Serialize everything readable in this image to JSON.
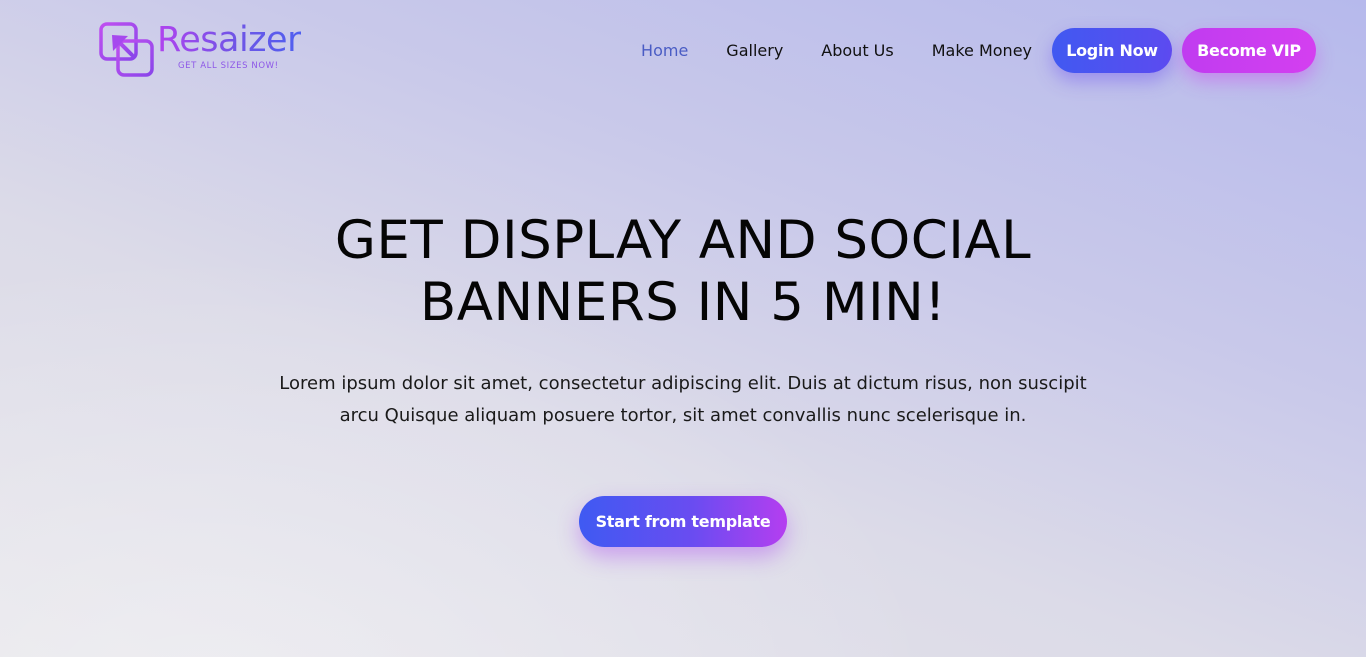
{
  "brand": {
    "name": "Resaizer",
    "tagline": "GET ALL SIZES NOW!",
    "logo_icon": "resize-arrow-icon",
    "colors": {
      "purple": "#b143ef",
      "blue": "#4f5ff0"
    }
  },
  "nav": {
    "items": [
      {
        "label": "Home",
        "active": true
      },
      {
        "label": "Gallery",
        "active": false
      },
      {
        "label": "About Us",
        "active": false
      },
      {
        "label": "Make Money",
        "active": false
      }
    ],
    "login_label": "Login Now",
    "vip_label": "Become VIP"
  },
  "hero": {
    "title_line1": "GET DISPLAY AND SOCIAL",
    "title_line2": "BANNERS IN 5 MIN!",
    "description": "Lorem ipsum dolor sit amet, consectetur adipiscing elit. Duis at dictum risus, non suscipit arcu Quisque aliquam posuere tortor, sit amet convallis nunc scelerisque in.",
    "cta_label": "Start from template"
  },
  "colors": {
    "nav_active": "#4a5cc4",
    "login_button": "#4159f1",
    "vip_button": "#c03cf0",
    "cta_gradient_start": "#3f5af2",
    "cta_gradient_end": "#b53ef0"
  }
}
